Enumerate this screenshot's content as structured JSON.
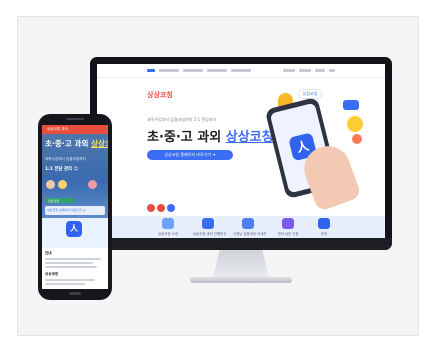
{
  "desktop": {
    "brand": "상상코칭",
    "subtitle": "과목수업부터 입결코칭까지 1:1 전담마크",
    "headline_main": "초·중·고 과외 ",
    "headline_accent": "상상코칭",
    "cta": "상상코칭 홈페이지 바로가기 ➜",
    "phone_badge": "상상코칭",
    "app_icon_glyph": "人",
    "menu": [
      {
        "label": "상상코칭 소개",
        "icon": "book-icon",
        "color": "#6fa0ff"
      },
      {
        "label": "상상코칭 과외 진행방식",
        "icon": "arrow-icon",
        "color": "#3a6cf4"
      },
      {
        "label": "선생님 검증과정 자세히",
        "icon": "people-icon",
        "color": "#4f7df5"
      },
      {
        "label": "관리 상담 신청",
        "icon": "trophy-icon",
        "color": "#7b5cf0"
      },
      {
        "label": "문의",
        "icon": "app-icon",
        "color": "#2f63ee"
      }
    ],
    "social_colors": [
      "#e94e3c",
      "#e94e3c",
      "#3a6cf4"
    ]
  },
  "mobile": {
    "topbar": "상상코칭 과외",
    "headline_main": "초·중·고 과외 ",
    "headline_accent": "상상코칭",
    "subtitle": "과목수업부터 입결코칭까지",
    "tagline": "1:1 전담 관리 😊",
    "action": "상담신청",
    "chip": "상상코칭 홈페이지 바로가기 ➜",
    "app_icon_glyph": "人",
    "section_label": "안내",
    "section_label2": "상상코칭"
  }
}
